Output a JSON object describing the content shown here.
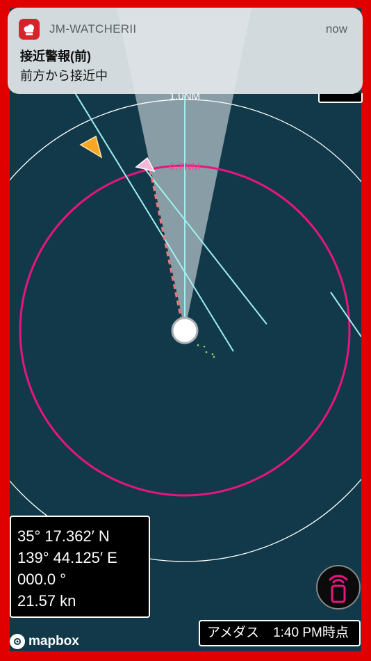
{
  "notification": {
    "app_name": "JM-WATCHERII",
    "time": "now",
    "title": "接近警報(前)",
    "body": "前方から接近中"
  },
  "radar": {
    "outer_ring_label": "1.0NM",
    "inner_ring_label": "0.7NM",
    "colors": {
      "background": "#12394a",
      "frame": "#e10000",
      "alert_ring": "#e8157e",
      "track_lines": "#9ef0f0",
      "outer_ring": "#ffffff",
      "target_pink": "#f4b7d8",
      "target_orange": "#f5a623",
      "approach_line": "#f07a7a"
    },
    "icons": [
      "own-ship-icon",
      "target-vessel-icon",
      "target-vessel-icon",
      "heading-cone"
    ]
  },
  "info_panel": {
    "latitude": "35° 17.362′ N",
    "longitude": "139° 44.125′ E",
    "heading": "000.0 °",
    "speed": "21.57 kn"
  },
  "amedas": {
    "label": "アメダス",
    "time": "1:40 PM時点"
  },
  "mapbox": {
    "label": "mapbox"
  }
}
